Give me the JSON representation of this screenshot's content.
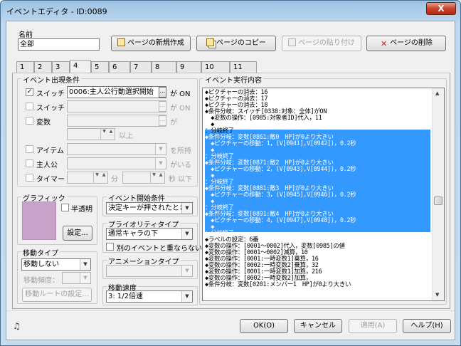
{
  "window": {
    "title": "イベントエディタ - ID:0089",
    "close": "X"
  },
  "name": {
    "label": "名前",
    "value": "全部"
  },
  "toolbar": {
    "new_page": "ページの新規作成",
    "copy_page": "ページのコピー",
    "paste_page": "ページの貼り付け",
    "delete_page": "ページの削除"
  },
  "tabs": [
    "1",
    "2",
    "3",
    "4",
    "5",
    "6",
    "7",
    "8",
    "9",
    "10",
    "11"
  ],
  "conditions": {
    "title": "イベント出現条件",
    "switch1": {
      "label": "スイッチ",
      "value": "0006:主人公行動選択開始",
      "suffix": "が ON",
      "checked": "✓"
    },
    "switch2": {
      "label": "スイッチ",
      "suffix": "が ON"
    },
    "variable": {
      "label": "変数",
      "suffix": "が",
      "unit": "以上"
    },
    "item": {
      "label": "アイテム",
      "suffix": "を所持"
    },
    "actor": {
      "label": "主人公",
      "suffix": "がいる"
    },
    "timer": {
      "label": "タイマー",
      "min": "分",
      "sec": "秒 以下"
    }
  },
  "graphic": {
    "title": "グラフィック",
    "transparent": "半透明",
    "settings": "設定..."
  },
  "trigger": {
    "title": "イベント開始条件",
    "value": "決定キーが押されたとき"
  },
  "priority": {
    "title": "プライオリティタイプ",
    "value": "通常キャラの下",
    "no_overlap": "別のイベントと重ならない"
  },
  "movement": {
    "title": "移動タイプ",
    "value": "移動しない",
    "freq_label": "移動頻度：",
    "route_button": "移動ルートの設定..."
  },
  "animation": {
    "title": "アニメーションタイプ"
  },
  "speed": {
    "title": "移動速度",
    "value": "3: 1/2倍速"
  },
  "commands": {
    "title": "イベント実行内容",
    "lines": [
      "◆ピクチャーの消去：16",
      "◆ピクチャーの消去：17",
      "◆ピクチャーの消去：18",
      "◆条件分岐：スイッチ[0338:対象：全体]がON",
      "　◆変数の操作：[0985:対象者ID]代入，11",
      "　◆",
      "：分岐終了",
      "◆条件分岐：変数[0861:敵0　HP]が0より大きい",
      "　◆ピクチャーの移動：1，(V[0941],V[0942])，0.2秒",
      "　◆",
      "：分岐終了",
      "◆条件分岐：変数[0871:敵2　HP]が0より大きい",
      "　◆ピクチャーの移動：2，(V[0943],V[0944])，0.2秒",
      "　◆",
      "：分岐終了",
      "◆条件分岐：変数[0881:敵3　HP]が0より大きい",
      "　◆ピクチャーの移動：3，(V[0945],V[0946])，0.2秒",
      "　◆",
      "：分岐終了",
      "◆条件分岐：変数[0891:敵4　HP]が0より大きい",
      "　◆ピクチャーの移動：4，(V[0947],V[0948])，0.2秒",
      "　◆",
      "：分岐終了",
      "◆ラベルの設定：6番",
      "◆変数の操作：[0001～0002]代入，変数[0985]の値",
      "◆変数の操作：[0001～0002]減算，10",
      "◆変数の操作：[0001:一時変数1]乗算，16",
      "◆変数の操作：[0002:一時変数2]乗算，32",
      "◆変数の操作：[0001:一時変数1]加算，216",
      "◆変数の操作：[0002:一時変数2]加算，",
      "◆条件分岐：変数[0201:メンバー1　HP]が0より大きい"
    ]
  },
  "footer": {
    "ok": "OK(O)",
    "cancel": "キャンセル",
    "apply": "適用(A)",
    "help": "ヘルプ(H)",
    "music_icon": "♫"
  }
}
